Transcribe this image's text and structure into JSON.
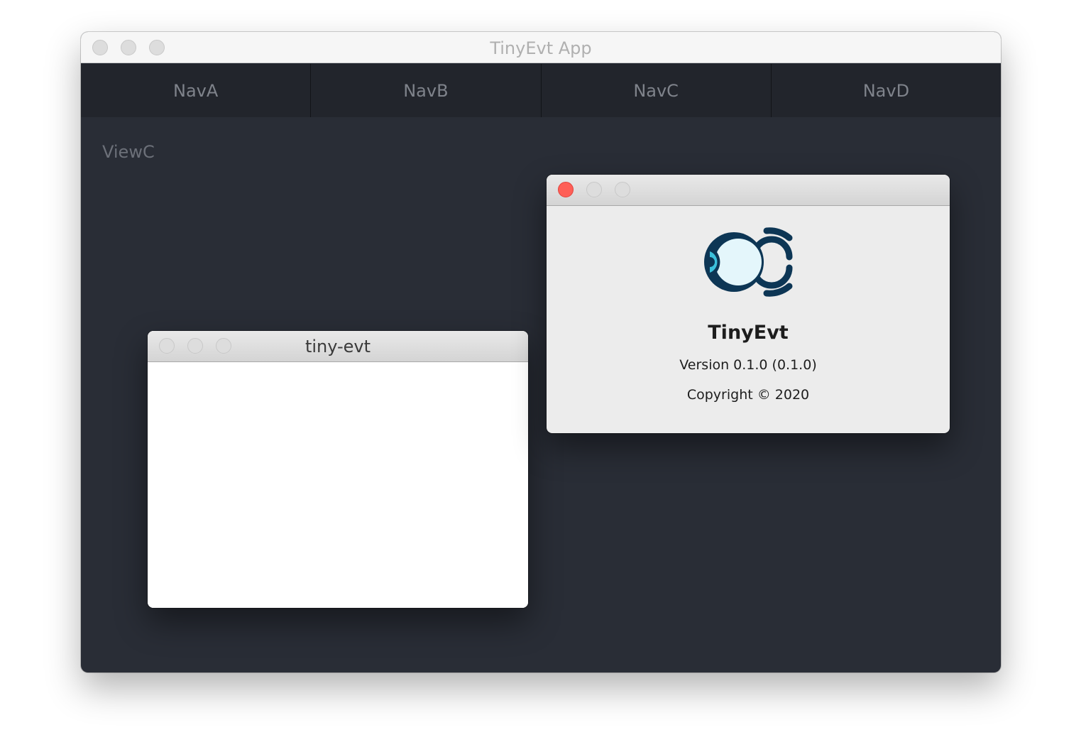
{
  "main_window": {
    "title": "TinyEvt App",
    "nav": [
      "NavA",
      "NavB",
      "NavC",
      "NavD"
    ],
    "active_view": "ViewC"
  },
  "child_window": {
    "title": "tiny-evt"
  },
  "about_window": {
    "app_name": "TinyEvt",
    "version": "Version 0.1.0 (0.1.0)",
    "copyright": "Copyright © 2020",
    "icon": "tinyevt-eye-logo-icon"
  },
  "colors": {
    "content_bg": "#292d36",
    "navbar_bg": "#22252c",
    "close_red": "#fe5f57",
    "logo_dark": "#0d3655",
    "logo_light": "#e4f6fb",
    "logo_cyan": "#3cc1dc"
  }
}
